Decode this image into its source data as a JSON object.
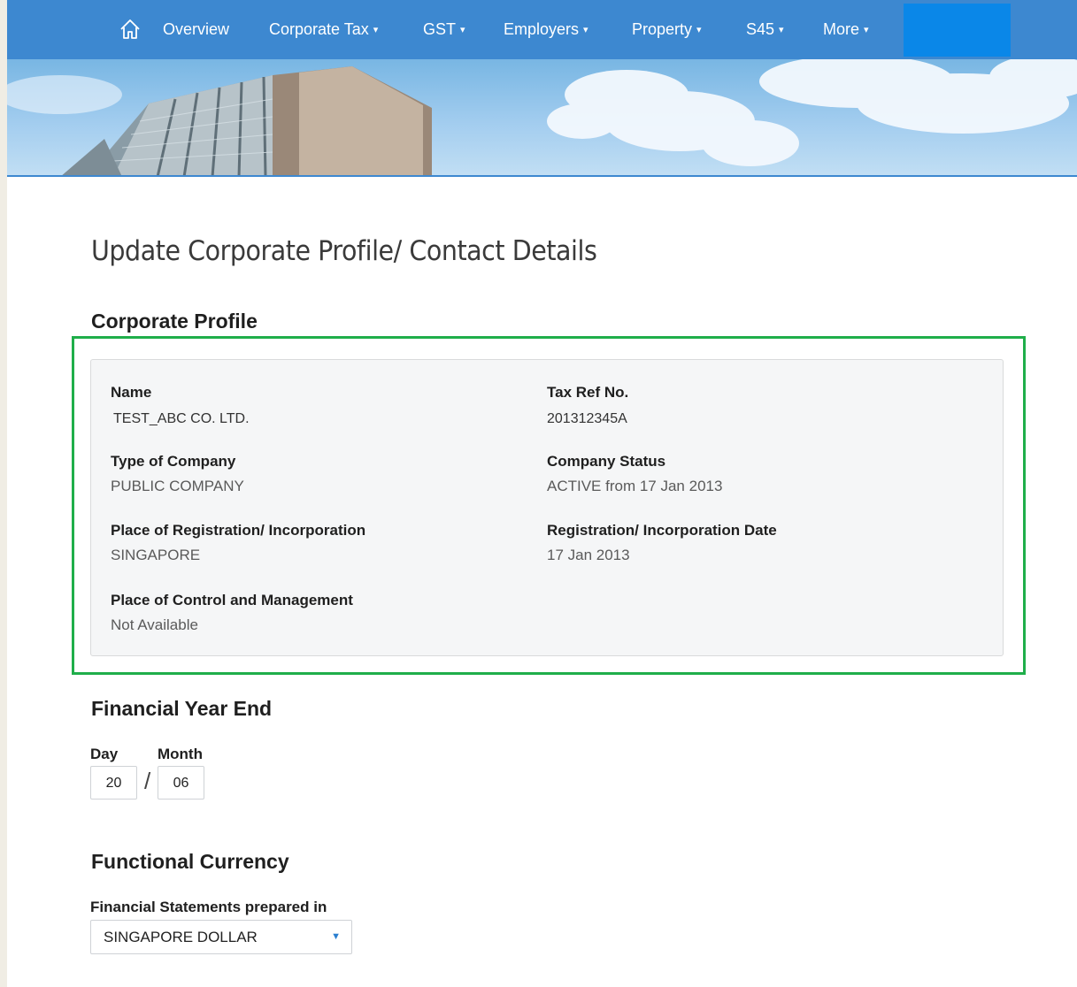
{
  "nav": {
    "items": [
      {
        "label": "Overview",
        "dropdown": false
      },
      {
        "label": "Corporate Tax",
        "dropdown": true
      },
      {
        "label": "GST",
        "dropdown": true
      },
      {
        "label": "Employers",
        "dropdown": true
      },
      {
        "label": "Property",
        "dropdown": true
      },
      {
        "label": "S45",
        "dropdown": true
      },
      {
        "label": "More",
        "dropdown": true
      }
    ],
    "caret": "▾",
    "home_icon": "home-icon"
  },
  "page": {
    "title": "Update Corporate Profile/ Contact Details"
  },
  "corporate_profile": {
    "heading": "Corporate Profile",
    "fields": {
      "name": {
        "label": "Name",
        "value": "TEST_ABC CO. LTD."
      },
      "tax_ref": {
        "label": "Tax Ref No.",
        "value": "201312345A"
      },
      "type": {
        "label": "Type of Company",
        "value": "PUBLIC COMPANY"
      },
      "status": {
        "label": "Company Status",
        "value": "ACTIVE from 17 Jan 2013"
      },
      "place_reg": {
        "label": "Place of Registration/ Incorporation",
        "value": "SINGAPORE"
      },
      "reg_date": {
        "label": "Registration/ Incorporation Date",
        "value": "17 Jan 2013"
      },
      "place_control": {
        "label": "Place of Control and Management",
        "value": "Not Available"
      }
    }
  },
  "financial_year_end": {
    "heading": "Financial Year End",
    "day_label": "Day",
    "month_label": "Month",
    "day_value": "20",
    "month_value": "06",
    "separator": "/"
  },
  "functional_currency": {
    "heading": "Functional Currency",
    "field_label": "Financial Statements prepared in",
    "selected": "SINGAPORE DOLLAR",
    "arrow": "▼"
  },
  "colors": {
    "nav_bg": "#3d88d0",
    "nav_highlight_box": "#0a87e8",
    "highlight_border": "#1fae4a",
    "card_bg": "#f5f6f7"
  }
}
